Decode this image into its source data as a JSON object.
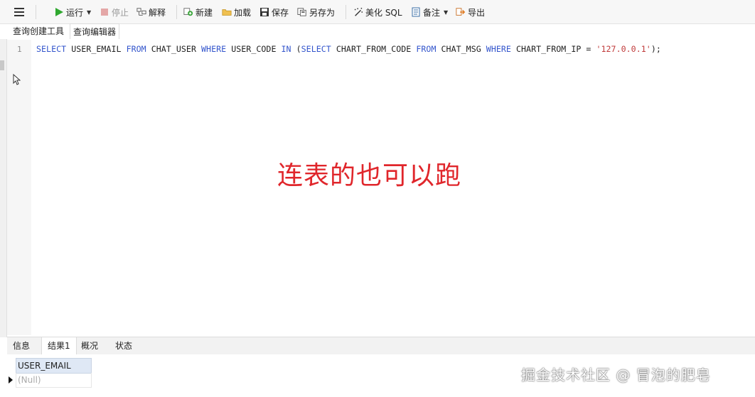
{
  "toolbar": {
    "run_label": "运行",
    "stop_label": "停止",
    "explain_label": "解释",
    "new_label": "新建",
    "load_label": "加载",
    "save_label": "保存",
    "saveas_label": "另存为",
    "beautify_label": "美化 SQL",
    "note_label": "备注",
    "export_label": "导出"
  },
  "subtabs": {
    "builder_label": "查询创建工具",
    "editor_label": "查询编辑器"
  },
  "editor": {
    "line_number": "1",
    "tokens": {
      "t1": "SELECT",
      "t2": " USER_EMAIL ",
      "t3": "FROM",
      "t4": " CHAT_USER ",
      "t5": "WHERE",
      "t6": " USER_CODE ",
      "t7": "IN",
      "t8": " (",
      "t9": "SELECT",
      "t10": " CHART_FROM_CODE ",
      "t11": "FROM",
      "t12": " CHAT_MSG ",
      "t13": "WHERE",
      "t14": " CHART_FROM_IP = ",
      "t15": "'127.0.0.1'",
      "t16": ");"
    }
  },
  "annotation": "连表的也可以跑",
  "bottom_tabs": {
    "info_label": "信息",
    "result_label": "结果1",
    "overview_label": "概况",
    "status_label": "状态"
  },
  "results": {
    "column_header": "USER_EMAIL",
    "cell_value": "(Null)"
  },
  "watermark": "掘金技术社区 @ 冒泡的肥皂",
  "colors": {
    "keyword": "#3355cc",
    "string": "#c03a3a",
    "annotation": "#e0262b",
    "run_icon": "#2fa82f"
  }
}
